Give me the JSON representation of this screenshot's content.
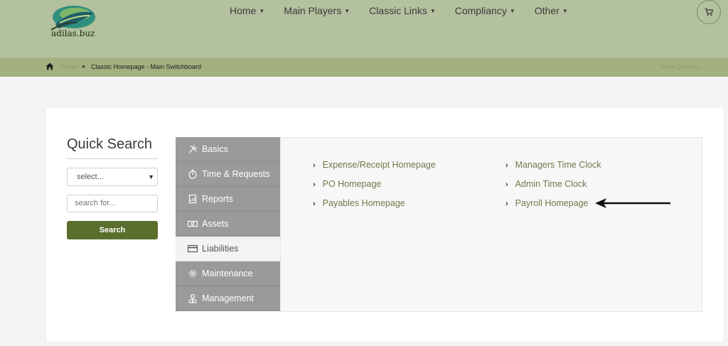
{
  "header": {
    "logo_text": "adilas.buz",
    "nav": [
      {
        "label": "Home"
      },
      {
        "label": "Main Players"
      },
      {
        "label": "Classic Links"
      },
      {
        "label": "Compliancy"
      },
      {
        "label": "Other"
      }
    ],
    "cart_icon": "cart-icon"
  },
  "breadcrumb": {
    "home": "Home",
    "separator": "»",
    "current": "Classic Homepage - Main Switchboard",
    "more_options": "More Options..."
  },
  "quick_search": {
    "title": "Quick Search",
    "select_value": "select...",
    "input_placeholder": "search for...",
    "button_label": "Search"
  },
  "tabs": [
    {
      "label": "Basics",
      "icon": "tools-icon",
      "active": false
    },
    {
      "label": "Time & Requests",
      "icon": "stopwatch-icon",
      "active": false
    },
    {
      "label": "Reports",
      "icon": "report-icon",
      "active": false
    },
    {
      "label": "Assets",
      "icon": "money-icon",
      "active": false
    },
    {
      "label": "Liabilities",
      "icon": "credit-card-icon",
      "active": true
    },
    {
      "label": "Maintenance",
      "icon": "gear-icon",
      "active": false
    },
    {
      "label": "Management",
      "icon": "user-tie-icon",
      "active": false
    }
  ],
  "links": {
    "col1": [
      "Expense/Receipt Homepage",
      "PO Homepage",
      "Payables Homepage"
    ],
    "col2": [
      "Managers Time Clock",
      "Admin Time Clock",
      "Payroll Homepage"
    ]
  },
  "colors": {
    "header_bg": "#b3c19e",
    "crumb_bg": "#a2b17f",
    "accent_green": "#5a6e2d",
    "link_color": "#6b7b49",
    "tab_bg": "#9a9a9a"
  }
}
